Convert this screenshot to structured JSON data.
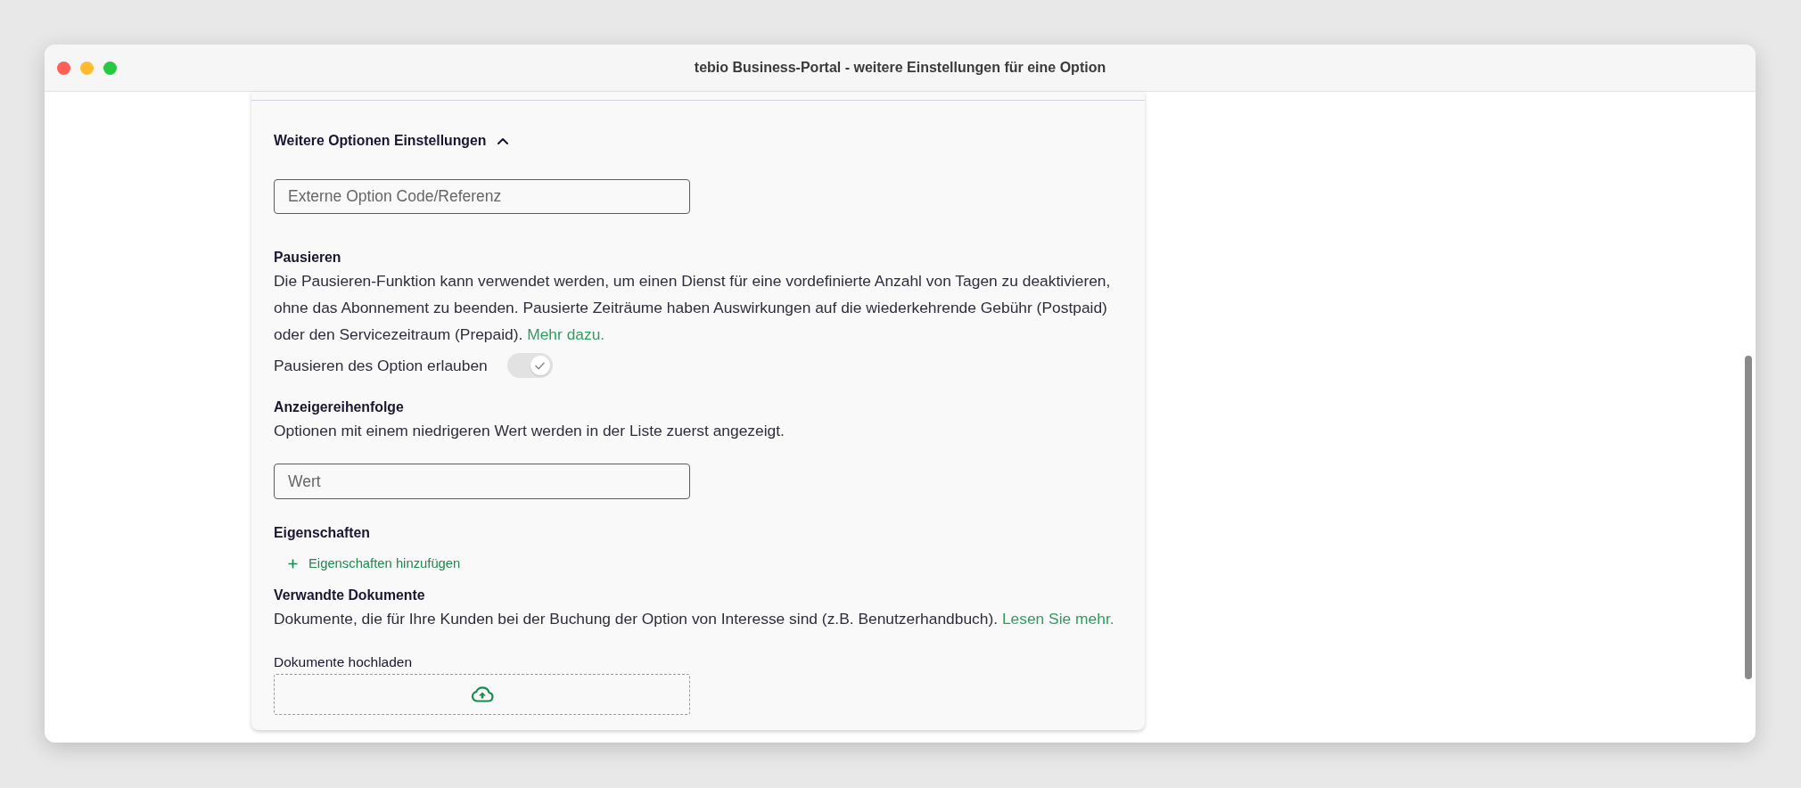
{
  "window": {
    "title": "tebio Business-Portal - weitere Einstellungen für eine Option"
  },
  "section": {
    "title": "Weitere Optionen Einstellungen",
    "expanded": true
  },
  "external_code_field": {
    "placeholder": "Externe Option Code/Referenz"
  },
  "pause": {
    "heading": "Pausieren",
    "description": "Die Pausieren-Funktion kann verwendet werden, um einen Dienst für eine vordefinierte Anzahl von Tagen zu deaktivieren, ohne das Abonnement zu beenden. Pausierte Zeiträume haben Auswirkungen auf die wiederkehrende Gebühr (Postpaid) oder den Servicezeitraum (Prepaid).",
    "link": "Mehr dazu.",
    "toggle": {
      "label": "Pausieren des Option erlauben",
      "on": true,
      "disabled": true
    }
  },
  "display_order": {
    "heading": "Anzeigereihenfolge",
    "description": "Optionen mit einem niedrigeren Wert werden in der Liste zuerst angezeigt.",
    "field": {
      "placeholder": "Wert"
    }
  },
  "properties": {
    "heading": "Eigenschaften",
    "add_button": "Eigenschaften hinzufügen"
  },
  "documents": {
    "heading": "Verwandte Dokumente",
    "description": "Dokumente, die für Ihre Kunden bei der Buchung der Option von Interesse sind (z.B. Benutzerhandbuch).",
    "link": "Lesen Sie mehr.",
    "upload_label": "Dokumente hochladen"
  }
}
